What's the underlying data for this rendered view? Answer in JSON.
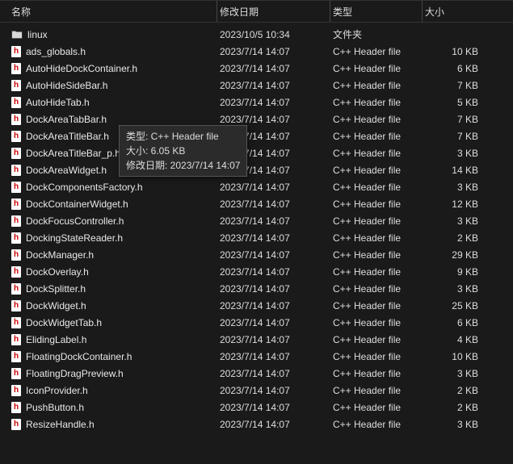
{
  "columns": {
    "name": "名称",
    "date": "修改日期",
    "type": "类型",
    "size": "大小"
  },
  "items": [
    {
      "icon": "folder",
      "name": "linux",
      "date": "2023/10/5 10:34",
      "type": "文件夹",
      "size": ""
    },
    {
      "icon": "hfile",
      "name": "ads_globals.h",
      "date": "2023/7/14 14:07",
      "type": "C++ Header file",
      "size": "10 KB"
    },
    {
      "icon": "hfile",
      "name": "AutoHideDockContainer.h",
      "date": "2023/7/14 14:07",
      "type": "C++ Header file",
      "size": "6 KB"
    },
    {
      "icon": "hfile",
      "name": "AutoHideSideBar.h",
      "date": "2023/7/14 14:07",
      "type": "C++ Header file",
      "size": "7 KB"
    },
    {
      "icon": "hfile",
      "name": "AutoHideTab.h",
      "date": "2023/7/14 14:07",
      "type": "C++ Header file",
      "size": "5 KB"
    },
    {
      "icon": "hfile",
      "name": "DockAreaTabBar.h",
      "date": "2023/7/14 14:07",
      "type": "C++ Header file",
      "size": "7 KB"
    },
    {
      "icon": "hfile",
      "name": "DockAreaTitleBar.h",
      "date": "2023/7/14 14:07",
      "type": "C++ Header file",
      "size": "7 KB"
    },
    {
      "icon": "hfile",
      "name": "DockAreaTitleBar_p.h",
      "date": "2023/7/14 14:07",
      "type": "C++ Header file",
      "size": "3 KB"
    },
    {
      "icon": "hfile",
      "name": "DockAreaWidget.h",
      "date": "2023/7/14 14:07",
      "type": "C++ Header file",
      "size": "14 KB"
    },
    {
      "icon": "hfile",
      "name": "DockComponentsFactory.h",
      "date": "2023/7/14 14:07",
      "type": "C++ Header file",
      "size": "3 KB"
    },
    {
      "icon": "hfile",
      "name": "DockContainerWidget.h",
      "date": "2023/7/14 14:07",
      "type": "C++ Header file",
      "size": "12 KB"
    },
    {
      "icon": "hfile",
      "name": "DockFocusController.h",
      "date": "2023/7/14 14:07",
      "type": "C++ Header file",
      "size": "3 KB"
    },
    {
      "icon": "hfile",
      "name": "DockingStateReader.h",
      "date": "2023/7/14 14:07",
      "type": "C++ Header file",
      "size": "2 KB"
    },
    {
      "icon": "hfile",
      "name": "DockManager.h",
      "date": "2023/7/14 14:07",
      "type": "C++ Header file",
      "size": "29 KB"
    },
    {
      "icon": "hfile",
      "name": "DockOverlay.h",
      "date": "2023/7/14 14:07",
      "type": "C++ Header file",
      "size": "9 KB"
    },
    {
      "icon": "hfile",
      "name": "DockSplitter.h",
      "date": "2023/7/14 14:07",
      "type": "C++ Header file",
      "size": "3 KB"
    },
    {
      "icon": "hfile",
      "name": "DockWidget.h",
      "date": "2023/7/14 14:07",
      "type": "C++ Header file",
      "size": "25 KB"
    },
    {
      "icon": "hfile",
      "name": "DockWidgetTab.h",
      "date": "2023/7/14 14:07",
      "type": "C++ Header file",
      "size": "6 KB"
    },
    {
      "icon": "hfile",
      "name": "ElidingLabel.h",
      "date": "2023/7/14 14:07",
      "type": "C++ Header file",
      "size": "4 KB"
    },
    {
      "icon": "hfile",
      "name": "FloatingDockContainer.h",
      "date": "2023/7/14 14:07",
      "type": "C++ Header file",
      "size": "10 KB"
    },
    {
      "icon": "hfile",
      "name": "FloatingDragPreview.h",
      "date": "2023/7/14 14:07",
      "type": "C++ Header file",
      "size": "3 KB"
    },
    {
      "icon": "hfile",
      "name": "IconProvider.h",
      "date": "2023/7/14 14:07",
      "type": "C++ Header file",
      "size": "2 KB"
    },
    {
      "icon": "hfile",
      "name": "PushButton.h",
      "date": "2023/7/14 14:07",
      "type": "C++ Header file",
      "size": "2 KB"
    },
    {
      "icon": "hfile",
      "name": "ResizeHandle.h",
      "date": "2023/7/14 14:07",
      "type": "C++ Header file",
      "size": "3 KB"
    }
  ],
  "tooltip": {
    "type_label": "类型: ",
    "type_value": "C++ Header file",
    "size_label": "大小: ",
    "size_value": "6.05 KB",
    "date_label": "修改日期: ",
    "date_value": "2023/7/14 14:07"
  }
}
